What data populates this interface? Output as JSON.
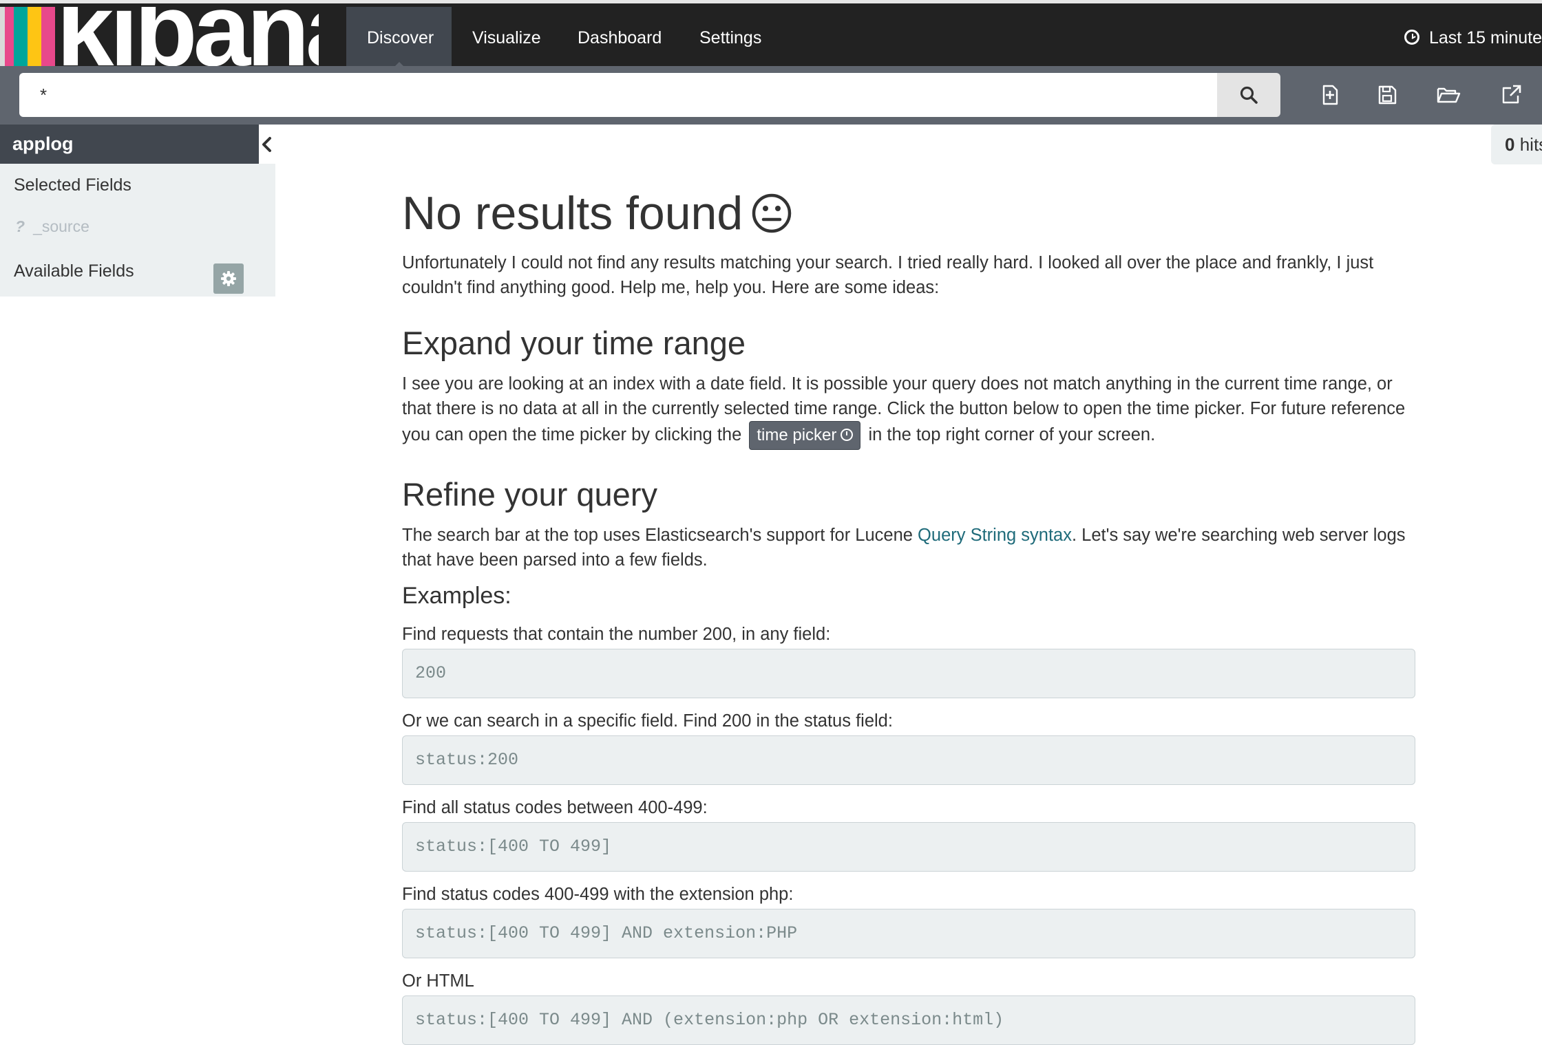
{
  "app": {
    "logo_text": "kibana",
    "logo_stripes": [
      "#d9d9d9",
      "#e8488b",
      "#00a69b",
      "#fec514",
      "#e8488b"
    ]
  },
  "nav": {
    "items": [
      {
        "label": "Discover",
        "active": true
      },
      {
        "label": "Visualize",
        "active": false
      },
      {
        "label": "Dashboard",
        "active": false
      },
      {
        "label": "Settings",
        "active": false
      }
    ],
    "timepicker_label": "Last 15 minute",
    "timepicker_icon": "clock-icon"
  },
  "search": {
    "value": "*",
    "button_icon": "search-icon",
    "toolbar_icons": [
      "new-search-icon",
      "save-icon",
      "open-folder-icon",
      "share-icon"
    ]
  },
  "sidebar": {
    "index_name": "applog",
    "collapse_icon": "chevron-left-icon",
    "selected_fields_label": "Selected Fields",
    "source_field_type": "?",
    "source_field_name": "_source",
    "available_fields_label": "Available Fields",
    "settings_icon": "gear-icon"
  },
  "hits": {
    "count": "0",
    "label": "hits"
  },
  "main": {
    "title": "No results found",
    "title_icon": "neutral-face-icon",
    "intro": "Unfortunately I could not find any results matching your search. I tried really hard. I looked all over the place and frankly, I just couldn't find anything good. Help me, help you. Here are some ideas:",
    "time_heading": "Expand your time range",
    "time_text_before": "I see you are looking at an index with a date field. It is possible your query does not match anything in the current time range, or that there is no data at all in the currently selected time range. Click the button below to open the time picker. For future reference you can open the time picker by clicking the",
    "time_picker_button": "time picker",
    "time_text_after": "in the top right corner of your screen.",
    "query_heading": "Refine your query",
    "query_text_before": "The search bar at the top uses Elasticsearch's support for Lucene",
    "query_link": "Query String syntax",
    "query_text_after": ". Let's say we're searching web server logs that have been parsed into a few fields.",
    "examples_heading": "Examples:",
    "examples": [
      {
        "label": "Find requests that contain the number 200, in any field:",
        "code": "200"
      },
      {
        "label": "Or we can search in a specific field. Find 200 in the status field:",
        "code": "status:200"
      },
      {
        "label": "Find all status codes between 400-499:",
        "code": "status:[400 TO 499]"
      },
      {
        "label": "Find status codes 400-499 with the extension php:",
        "code": "status:[400 TO 499] AND extension:PHP"
      },
      {
        "label": "Or HTML",
        "code": "status:[400 TO 499] AND (extension:php OR extension:html)"
      }
    ]
  }
}
